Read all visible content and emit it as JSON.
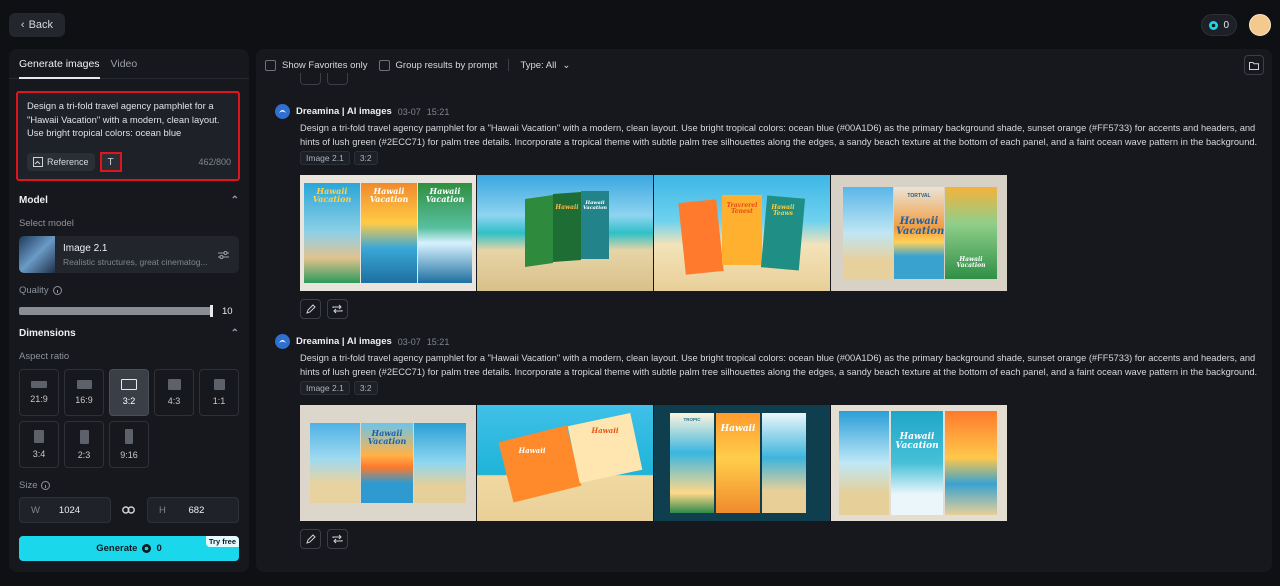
{
  "header": {
    "back_label": "Back",
    "credits": "0"
  },
  "sidebar": {
    "tabs": [
      {
        "label": "Generate images",
        "active": true
      },
      {
        "label": "Video",
        "active": false
      }
    ],
    "prompt": {
      "text": "Design a tri-fold travel agency pamphlet for a \"Hawaii Vacation\" with a modern, clean layout. Use bright tropical colors: ocean blue (#00A1D6) as the primary background shade, sunset orange (#FF5733) for accents and headers, and hints of lush green (#2ECC71) for palm tree details.",
      "reference_label": "Reference",
      "char_count": "462/800"
    },
    "model": {
      "section": "Model",
      "select_label": "Select model",
      "name": "Image 2.1",
      "description": "Realistic structures, great cinematog..."
    },
    "quality": {
      "label": "Quality",
      "value": "10"
    },
    "dimensions": {
      "section": "Dimensions",
      "aspect_label": "Aspect ratio",
      "ratios": [
        {
          "label": "21:9",
          "selected": false
        },
        {
          "label": "16:9",
          "selected": false
        },
        {
          "label": "3:2",
          "selected": true
        },
        {
          "label": "4:3",
          "selected": false
        },
        {
          "label": "1:1",
          "selected": false
        },
        {
          "label": "3:4",
          "selected": false
        },
        {
          "label": "2:3",
          "selected": false
        },
        {
          "label": "9:16",
          "selected": false
        }
      ],
      "size_label": "Size",
      "width_key": "W",
      "width": "1024",
      "height_key": "H",
      "height": "682"
    },
    "generate": {
      "label": "Generate",
      "cost": "0",
      "badge": "Try free"
    }
  },
  "main": {
    "toolbar": {
      "favorites": "Show Favorites only",
      "group": "Group results by prompt",
      "type": "Type: All"
    },
    "results": [
      {
        "source": "Dreamina | AI images",
        "date": "03-07",
        "time": "15:21",
        "prompt": "Design a tri-fold travel agency pamphlet for a \"Hawaii Vacation\" with a modern, clean layout. Use bright tropical colors: ocean blue (#00A1D6) as the primary background shade, sunset orange (#FF5733) for accents and headers, and hints of lush green (#2ECC71) for palm tree details. Incorporate a tropical theme with subtle palm tree silhouettes along the edges, a sandy beach texture at the bottom of each panel, and a faint ocean wave pattern in the background.",
        "tags": [
          "Image 2.1",
          "3:2"
        ],
        "images": [
          {
            "texts": [
              "Hawaii Vacation",
              "Hawaii Vacation",
              "Hawaii Vacation"
            ]
          },
          {
            "texts": [
              "Hawaii",
              "Hawaii Vacation"
            ]
          },
          {
            "texts": [
              "Travrerel Tenest",
              "Hawaii Teaws"
            ]
          },
          {
            "texts": [
              "TORTVAL",
              "Hawaii Vacation",
              "Hawaii Vacation"
            ]
          }
        ]
      },
      {
        "source": "Dreamina | AI images",
        "date": "03-07",
        "time": "15:21",
        "prompt": "Design a tri-fold travel agency pamphlet for a \"Hawaii Vacation\" with a modern, clean layout. Use bright tropical colors: ocean blue (#00A1D6) as the primary background shade, sunset orange (#FF5733) for accents and headers, and hints of lush green (#2ECC71) for palm tree details. Incorporate a tropical theme with subtle palm tree silhouettes along the edges, a sandy beach texture at the bottom of each panel, and a faint ocean wave pattern in the background.",
        "tags": [
          "Image 2.1",
          "3:2"
        ],
        "images": [
          {
            "texts": [
              "Hawaii Vacation"
            ]
          },
          {
            "texts": [
              "Hawaii",
              "Hawaii"
            ]
          },
          {
            "texts": [
              "TROPIC",
              "Hawaii"
            ]
          },
          {
            "texts": [
              "Hawaii Vacation"
            ]
          }
        ]
      }
    ]
  },
  "colors": {
    "accent": "#1bd7ec",
    "highlight": "#e0141f",
    "panel": "#16181d"
  }
}
